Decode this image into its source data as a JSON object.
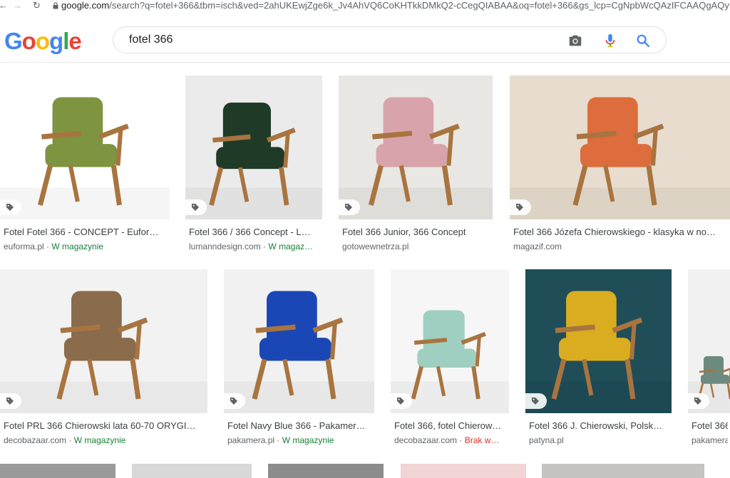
{
  "browser": {
    "url_host": "google.com",
    "url_rest": "/search?q=fotel+366&tbm=isch&ved=2ahUKEwjZge6k_Jv4AhVQ6CoKHTkkDMkQ2-cCegQIABAA&oq=fotel+366&gs_lcp=CgNpbWcQAzIFCAAQgAQyBQ"
  },
  "header": {
    "logo_letters": [
      "G",
      "o",
      "o",
      "g",
      "l",
      "e"
    ],
    "search_query": "fotel 366"
  },
  "colors": {
    "google_blue": "#4285f4",
    "google_red": "#ea4335",
    "google_yellow": "#fbbc05",
    "google_green": "#34a853",
    "stock_green": "#188038",
    "stock_red": "#d93025"
  },
  "results": [
    {
      "title": "Fotel Fotel 366 - CONCEPT - Eufor…",
      "site": "euforma.pl",
      "sep": " · ",
      "stock": "W magazynie",
      "stock_status": "in",
      "chair_color": "#7e9441",
      "bg": "#ffffff"
    },
    {
      "title": "Fotel 366 / 366 Concept - L…",
      "site": "lumanndesign.com",
      "sep": " · ",
      "stock": "W magaz…",
      "stock_status": "in",
      "chair_color": "#1f3b28",
      "bg": "#ebebeb"
    },
    {
      "title": "Fotel 366 Junior, 366 Concept",
      "site": "gotowewnetrza.pl",
      "sep": "",
      "stock": "",
      "stock_status": "",
      "chair_color": "#d9a3ab",
      "bg": "#e9e7e3"
    },
    {
      "title": "Fotel 366 Józefa Chierowskiego - klasyka w no…",
      "site": "magazif.com",
      "sep": "",
      "stock": "",
      "stock_status": "",
      "chair_color": "#dd6d3c",
      "bg": "#e7dccd"
    },
    {
      "title": "Fotel PRL 366 Chierowski lata 60-70 ORYGI…",
      "site": "decobazaar.com",
      "sep": " · ",
      "stock": "W magazynie",
      "stock_status": "in",
      "chair_color": "#8a6b4b",
      "bg": "#f2f2f2"
    },
    {
      "title": "Fotel Navy Blue 366 - Pakamer…",
      "site": "pakamera.pl",
      "sep": " · ",
      "stock": "W magazynie",
      "stock_status": "in",
      "chair_color": "#1a47b5",
      "bg": "#f1f1f1"
    },
    {
      "title": "Fotel 366, fotel Chierow…",
      "site": "decobazaar.com",
      "sep": " · ",
      "stock": "Brak w…",
      "stock_status": "out",
      "chair_color": "#9fcfc0",
      "bg": "#f6f6f6"
    },
    {
      "title": "Fotel 366 J. Chierowski, Polsk…",
      "site": "patyna.pl",
      "sep": "",
      "stock": "",
      "stock_status": "",
      "chair_color": "#d9ad1f",
      "bg": "#1f4d58"
    },
    {
      "title": "Fotel 366",
      "site": "pakamera",
      "sep": "",
      "stock": "",
      "stock_status": "",
      "chair_color": "#6d8a7e",
      "bg": "#f1f1f1"
    }
  ]
}
